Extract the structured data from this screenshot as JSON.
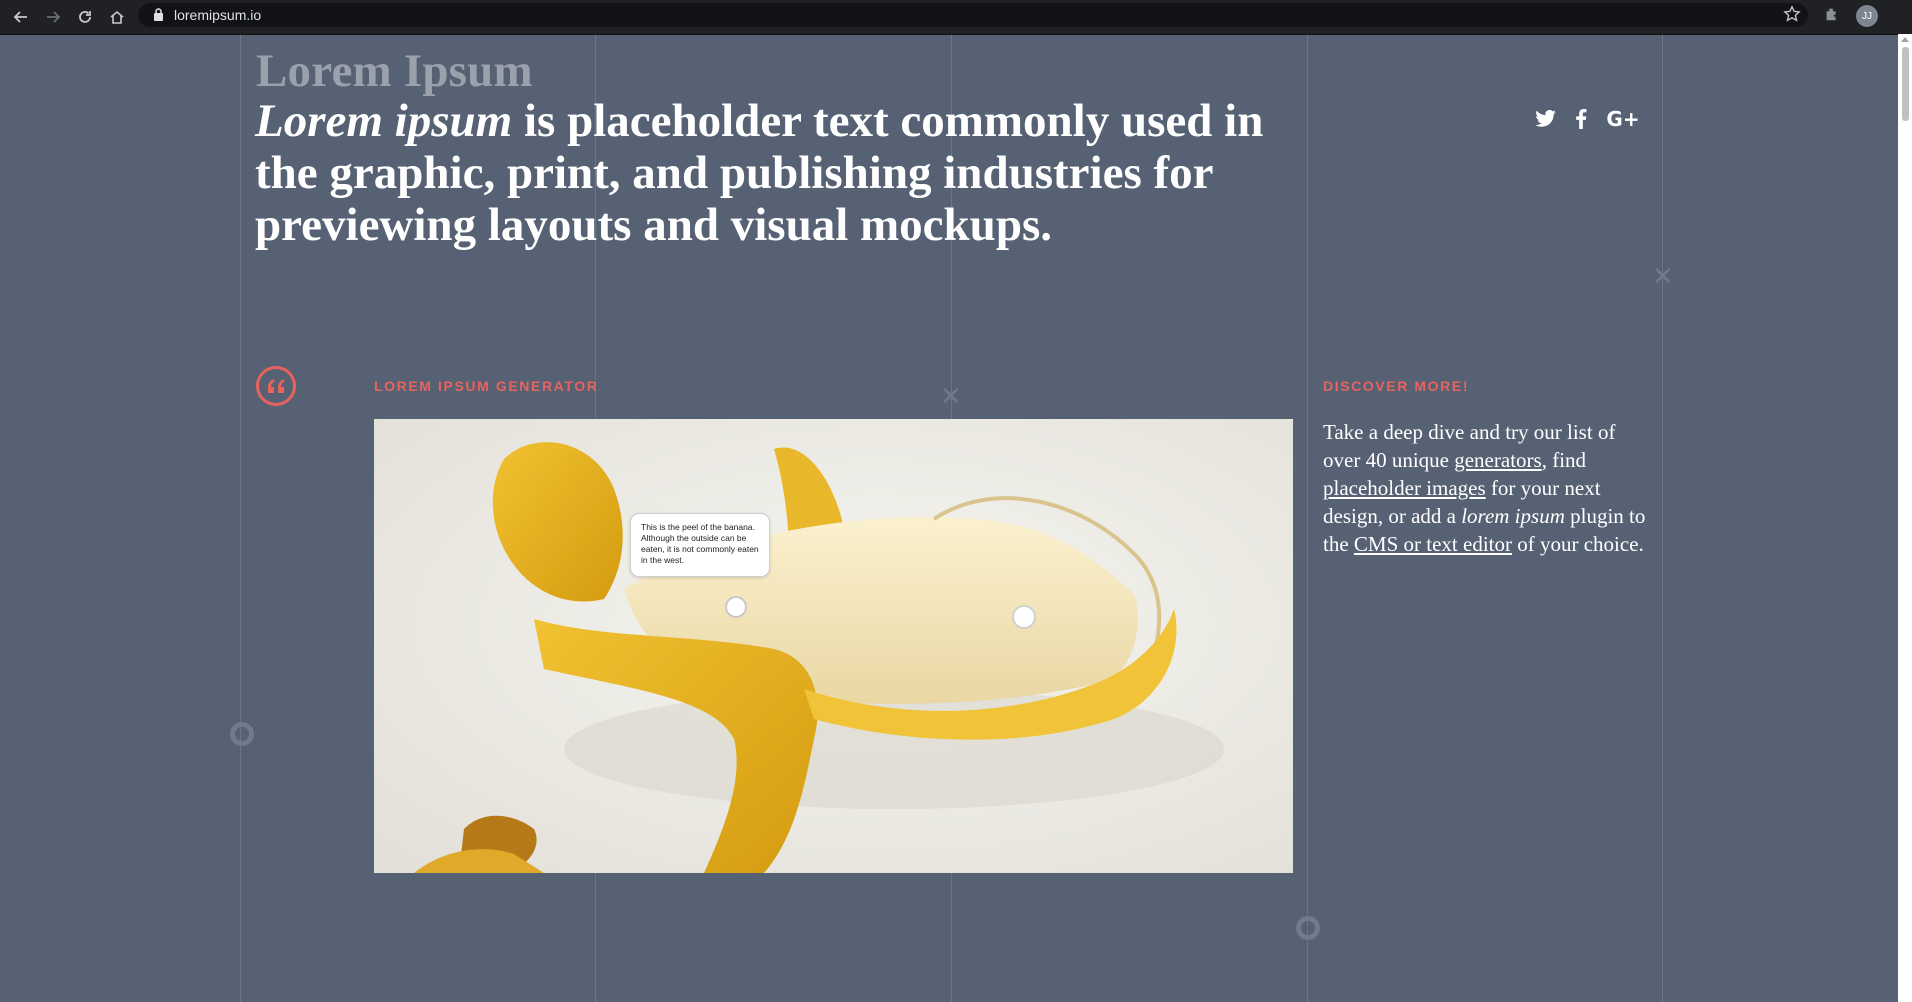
{
  "browser": {
    "url": "loremipsum.io",
    "avatar_initials": "JJ",
    "icons": [
      "back-icon",
      "forward-icon",
      "reload-icon",
      "home-icon",
      "lock-icon",
      "star-icon",
      "extensions-icon"
    ]
  },
  "header": {
    "site_title": "Lorem Ipsum",
    "headline_em": "Lorem ipsum",
    "headline_rest": " is placeholder text commonly used in the graphic, print, and publishing industries for previewing layouts and visual mockups."
  },
  "social": {
    "icons": [
      "twitter-icon",
      "facebook-icon",
      "google-plus-icon"
    ],
    "gplus_label": "G+"
  },
  "generator": {
    "label": "LOREM IPSUM GENERATOR",
    "quote_icon": "quote-icon",
    "image": {
      "alt": "Peeled banana",
      "tooltip_text": "This is the peel of the banana. Although the outside can be eaten, it is not commonly eaten in the west."
    }
  },
  "discover": {
    "label": "DISCOVER MORE!",
    "text_1": "Take a deep dive and try our list of over 40 unique ",
    "link_generators": "generators",
    "text_2": ", find ",
    "link_images": "placeholder images",
    "text_3": " for your next design, or add a ",
    "em_lorem": "lorem ipsum",
    "text_4": " plugin to the ",
    "link_cms": "CMS or text editor",
    "text_5": " of your choice."
  },
  "colors": {
    "background": "#566173",
    "accent": "#e8625e",
    "text": "#ffffff",
    "muted_title": "#9aa1ac"
  }
}
